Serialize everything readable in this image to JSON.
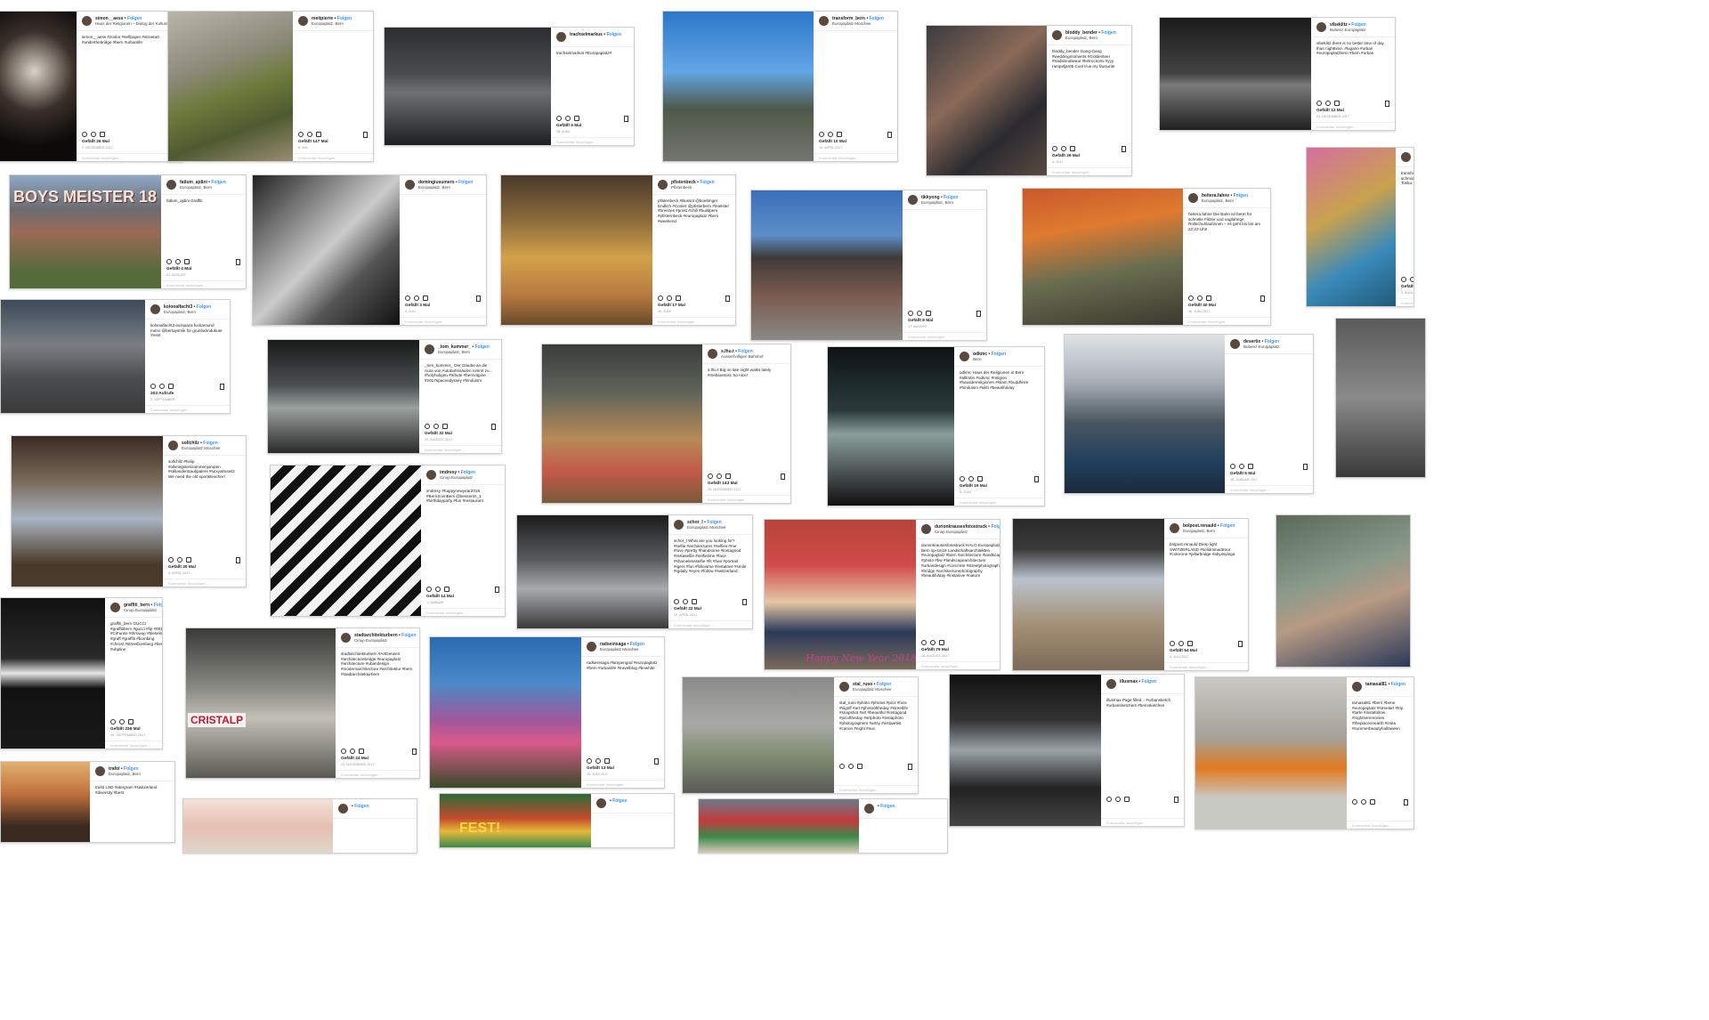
{
  "ui": {
    "follow": "Folgen",
    "comment_placeholder": "Kommentar hinzufügen ..."
  },
  "posts": [
    {
      "user": "simon__aess",
      "location": "Haus der Religionen – Dialog der Kulturen",
      "caption": "simon__aess #zoolor #selfpaper #streetart #underthebridge #bern #urbanlife",
      "likes": "Gefällt 26 Mal",
      "date": "2. DEZEMBER 2017"
    },
    {
      "user": "meitpierre",
      "location": "Europaplatz, Bern",
      "caption": "",
      "likes": "Gefällt 147 Mal",
      "date": "8. MAI"
    },
    {
      "user": "trachselmarkus",
      "location": "",
      "caption": "trachselmarkus #Europaplatz#",
      "likes": "Gefällt 5 Mal",
      "date": "28. JUNI"
    },
    {
      "user": "transform_bern",
      "location": "Europaplatz Moschee",
      "caption": "",
      "likes": "Gefällt 10 Mal",
      "date": "14. APRIL 2017"
    },
    {
      "user": "bloddy_bender",
      "location": "Europaplatz, Bern",
      "caption": "bloddy_bender Gang-Gang #weddingmoments #Goldenteer #traditionalwear #ketrucsomi #yyy rampeljar05 Cool true my favourite",
      "likes": "Gefällt 29 Mal",
      "date": "4. JULI"
    },
    {
      "user": "vibeklitz",
      "location": "Bubeez Europaplatz",
      "caption": "vibeklitz there is no better time of day than nighttime. #lugano #urban #europaplatzbern #bern #urban",
      "likes": "Gefällt 12 Mal",
      "date": "21. DEZEMBER 2017"
    },
    {
      "user": "fatlum_ajdini",
      "location": "Europaplatz, Bern",
      "caption": "fatlum_ajdini Graffiti",
      "likes": "Gefällt 4 Mal",
      "date": "22. AUGUST"
    },
    {
      "user": "domingiusumero",
      "location": "Europaplatz, Bern",
      "caption": "",
      "likes": "Gefällt 3 Mal",
      "date": "4. JULI"
    },
    {
      "user": "pfistenbeck",
      "location": "Pfistenbeck",
      "caption": "pfistenbeck #Bussol @boeltmger Endlich #Cooler @pfisterbern #intelster #breezes #prost #chill #buildpers #pfisternbeck #europaplatz #bern #weekend",
      "likes": "Gefällt 17 Mal",
      "date": "30. JUNI"
    },
    {
      "user": "tikkyong",
      "location": "Europaplatz, Bern",
      "caption": "",
      "likes": "Gefällt 9 Mal",
      "date": "17. AUGUST"
    },
    {
      "user": "heitera.fahne",
      "location": "Europaplatz, Bern",
      "caption": "heitera.fahne Die Bahn ist beret für schnelle Flitzer und nagfahrige Rollschuhlaufinnen – es geht los bis am 22:23 Uhr!",
      "likes": "Gefällt 40 Mal",
      "date": "30. JUNI 2017"
    },
    {
      "user": "transform_bern",
      "location": "Bubeez Europaplatz",
      "caption": "transform_bern Gregois ReZiC schmidt auf dem Europaplatz Tosku.",
      "likes": "Gefällt 4 Mal",
      "date": "2. AUGUST 2017"
    },
    {
      "user": "kolonalfacht3",
      "location": "Europaplatz, Bern",
      "caption": "kolonalfacht3 europaza fuckaround merci @bertaysmik for grunbahndukute Yesst",
      "likes": "203 Aufrufe",
      "date": "2. SEPTEMBER"
    },
    {
      "user": "_tom_kummer_",
      "location": "Europaplatz, Bern",
      "caption": "_tom_kummer_ Der Glaube an die Aura von Autobahnsäulen nimmt zu... #holyhuligen #tribute #bernvitgine #2017spaceodyssey #hinduism",
      "likes": "Gefällt 32 Mal",
      "date": "20. AUGUST 2017"
    },
    {
      "user": "s.lhu.t",
      "location": "Ausserholligen Bahnhof",
      "caption": "s.lhu.t Big on late night walks lately #mebluemisc So nice!",
      "likes": "Gefällt 143 Mal",
      "date": "25. NOVEMBER 2017"
    },
    {
      "user": "odkmc",
      "location": "Bern",
      "caption": "odkmc Haus der Religionen in Bern #alltmtin #odkmc #religion #hausderreligionen #islam #buddhism #hinduism #sikh #beautifulday",
      "likes": "Gefällt 19 Mal",
      "date": "6. JUNI"
    },
    {
      "user": "desertix",
      "location": "Bubeez Europaplatz",
      "caption": "",
      "likes": "Gefällt 5 Mal",
      "date": "18. JANUAR 2017"
    },
    {
      "user": "fotomarbach.ch_schweiz",
      "location": "Bubeez Europaplatz",
      "caption": "fotomarbach.ch_schweiz #everydaystories #berne #citylife #bern #streetphotographer #bnw #works_bnw #streetgraphie #blackwhite #streetphotography #bernmarbach",
      "likes": "Gefällt 49 Mal",
      "date": "20. APRIL"
    },
    {
      "user": "sollchilz",
      "location": "Europaplatz Moschee",
      "caption": "sollchilz #hiriip #ollieingsterkrammenjumpen #stillanderstaubpalers #sexyalmseitz We need the old sportsteacher!",
      "likes": "Gefällt 30 Mal",
      "date": "5. APRIL 2017"
    },
    {
      "user": "imdresy",
      "location": "Cinop Europaplatz",
      "caption": "imdresy #happynewyear2018 #BernScenBeni @besserim_1 #birthdayparty #fun #restaurant",
      "likes": "Gefällt 14 Mal",
      "date": "1. JANUAR"
    },
    {
      "user": "schor_l",
      "location": "Europaplatz Moschee",
      "caption": "schor_l What are you looking for? #selfie #architectures #selfies #me #love #pretty #handsome #instagood #instaselfie #selfietime #face #shamelessselfie #fit #hair #portrait #igers #fun #followme #instalove #smile #igdaily #eyes #follow #switzerland",
      "likes": "Gefällt 22 Mal",
      "date": "22. APRIL 2017"
    },
    {
      "user": "durionkrausesfotostruck",
      "location": "Cinop Europaplatz",
      "caption": "durionkrausesfotostruck HALO Europaplatz Bern sp-sm19 Landschaftsarchitekten #europaplatz #bern #architecture #landscape #photo #bw #landscapearchitecture #urbandesign #concrete #streetphotography #bridge #architecturephotography #beautifulday #instalove #nature",
      "likes": "Gefällt 79 Mal",
      "date": "28. AUGUST 2017"
    },
    {
      "user": "bolpost.renauld",
      "location": "Europaplatz, Bern",
      "caption": "bolpost.renauld Deep light SWITZERLAND #solidminadtreur #colorone #pillarbridge #abyssyinga",
      "likes": "Gefällt 54 Mal",
      "date": "5. JULI 2017"
    },
    {
      "user": "radseinsaga",
      "location": "Haus der Religionen – Dialog der Kulturen",
      "caption": "radseinsaga #holyhuligen #sikhunbeligenwerbenzenfilnes #hinduismbernbemphmos #shrigebusereustensbeGerdenumme",
      "likes": "Gefällt 11 Mal",
      "date": "15. AUGUST"
    },
    {
      "user": "graffiti_bern",
      "location": "Cinop Europaplatz",
      "caption": "graffiti_bern GUCCI #graffitibern #gucci #fip #001 #CiFunse #throwup #bleselo #graff #graffiti #bombing #chrost #streetbombing #bern #ubpline",
      "likes": "Gefällt 336 Mal",
      "date": "29. SEPTEMBER 2017"
    },
    {
      "user": "stadtarchitekturbern",
      "location": "Cinop Europaplatz",
      "caption": "stadtarchitekturbern #ArtDerweit #architecturebridge #europaplatz #architecture #ubandesign #modernarchitecture #architektur #bern #stadtarchitekturbern",
      "likes": "Gefällt 24 Mal",
      "date": "22. NOVEMBER 2017"
    },
    {
      "user": "radseinsaga",
      "location": "Europaplatz Moschee",
      "caption": "radseinsaga #lampengod #europaplatz #bern #urbanlife #travelblog #bnwhite",
      "likes": "Gefällt 13 Mal",
      "date": "15. JUNI 2017"
    },
    {
      "user": "stal_ruso",
      "location": "Europaplatz Moschee",
      "caption": "stal_ruso #photo #photos #pics #nice #bigoff #art #photooftheday #streetlife #snapshot #art #beautiful #instagood #picoftheday #artphoto #instaphoto #photographers #artsy #instaartist #canon #night #sun",
      "likes": "",
      "date": ""
    },
    {
      "user": "illusmax",
      "location": "",
      "caption": "illusmax Page filled... #urbansketch #urbansketchers #bernsketches",
      "likes": "",
      "date": ""
    },
    {
      "user": "tamasal81",
      "location": "",
      "caption": "tamasal81 #bern #bene #europaplatz #streetart #trip #tarte #instafollow #nightseremonies #theplaceonearth #insta #summerbeautyhalloween",
      "likes": "",
      "date": ""
    },
    {
      "user": "trafol",
      "location": "Europaplatz, Bern",
      "caption": "trafol LSD #atergram #switzerland #diversity #best",
      "likes": "",
      "date": ""
    }
  ],
  "overlay_text": {
    "graffiti_wall": "BOYS MEISTER 18",
    "happy_new_year": "Happy New Year 2018",
    "bottle_label": "CRISTALP",
    "banner_bottom": "FEST!"
  }
}
